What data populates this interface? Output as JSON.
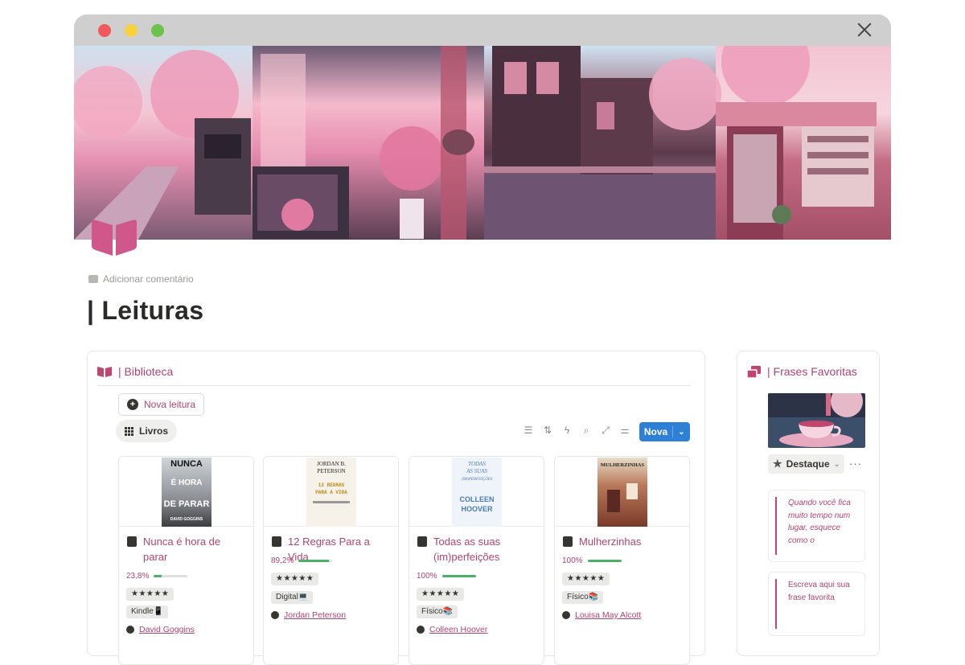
{
  "window": {
    "controls": [
      "close",
      "minimize",
      "maximize"
    ]
  },
  "page": {
    "comment_label": "Adicionar comentário",
    "title": "| Leituras"
  },
  "biblioteca": {
    "header": "| Biblioteca",
    "new_reading_label": "Nova leitura",
    "view_tab_label": "Livros",
    "new_button_label": "Nova",
    "toolbar_icons": [
      "filter-icon",
      "sort-icon",
      "automation-icon",
      "search-icon",
      "expand-icon",
      "settings-icon"
    ],
    "books": [
      {
        "title": "Nunca é hora de parar",
        "cover_text": [
          "NUNCA",
          "É HORA",
          "DE PARAR",
          "DAVID GOGGINS"
        ],
        "progress_label": "23,8%",
        "progress": 0.238,
        "rating": "★★★★★",
        "format": "Kindle📱",
        "author": "David Goggins"
      },
      {
        "title": "12 Regras Para a Vida",
        "cover_text": [
          "JORDAN B.",
          "PETERSON",
          "12 REGRAS",
          "PARA A VIDA"
        ],
        "progress_label": "89,2%",
        "progress": 0.892,
        "rating": "★★★★★",
        "format": "Digital💻",
        "author": "Jordan Peterson"
      },
      {
        "title": "Todas as suas (im)perfeições",
        "cover_text": [
          "TODAS",
          "AS SUAS",
          "(IM)PERFEIÇÕES",
          "COLLEEN",
          "HOOVER"
        ],
        "progress_label": "100%",
        "progress": 1.0,
        "rating": "★★★★★",
        "format": "Físico📚",
        "author": "Colleen Hoover"
      },
      {
        "title": "Mulherzinhas",
        "cover_text": [
          "MULHERZINHAS"
        ],
        "progress_label": "100%",
        "progress": 1.0,
        "rating": "★★★★★",
        "format": "Físico📚",
        "author": "Louisa May Alcott"
      }
    ]
  },
  "frases": {
    "header": "| Frases Favoritas",
    "filter_label": "Destaque",
    "quotes": [
      "Quando você fica muito tempo num lugar, esquece como o",
      "Escreva aqui sua frase favorita"
    ]
  },
  "colors": {
    "accent": "#b0446f",
    "primary_button": "#2e7fd6",
    "progress": "#4caf6a"
  }
}
